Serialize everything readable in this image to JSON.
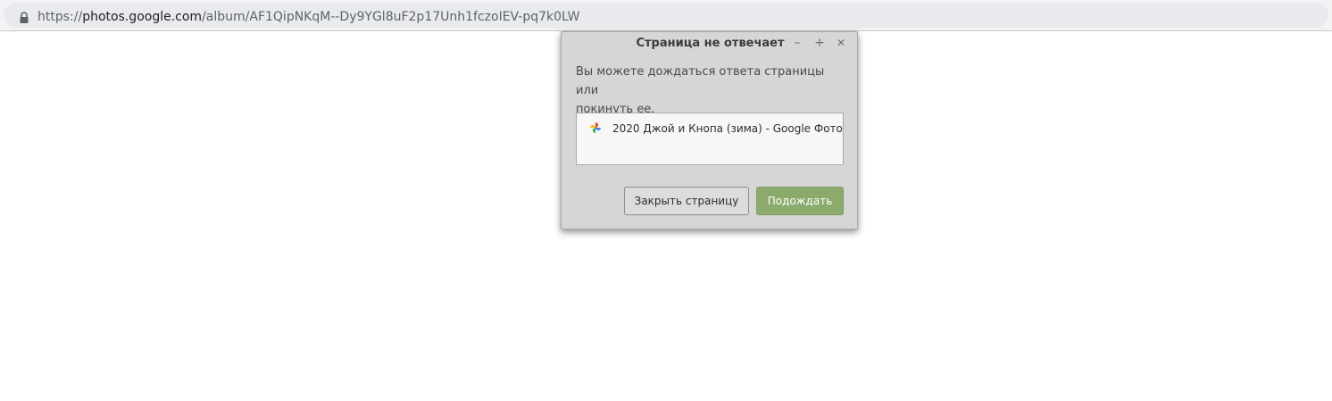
{
  "browser": {
    "url_scheme": "https://",
    "url_host": "photos.google.com",
    "url_path": "/album/AF1QipNKqM--Dy9YGl8uF2p17Unh1fczoIEV-pq7k0LW",
    "lock_icon": "lock-icon"
  },
  "dialog": {
    "title": "Страница не отвечает",
    "minimize_label": "–",
    "maximize_label": "+",
    "close_label": "✕",
    "message_line1": "Вы можете дождаться ответа страницы или",
    "message_line2": "покинуть ее.",
    "pages": [
      {
        "title": "2020 Джой и Кнопа (зима) - Google Фото",
        "icon": "google-photos-icon"
      }
    ],
    "close_page_button": "Закрыть страницу",
    "wait_button": "Подождать",
    "colors": {
      "wait_button": "#8bab6d",
      "dialog_bg": "#d6d6d6"
    }
  }
}
